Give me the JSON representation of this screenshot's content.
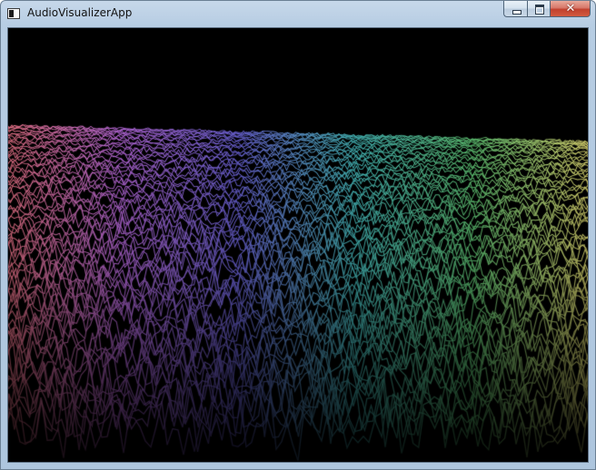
{
  "window": {
    "title": "AudioVisualizerApp",
    "app_icon": "console-window-icon"
  },
  "caption_buttons": {
    "minimize_icon": "minimize-icon",
    "maximize_icon": "maximize-icon",
    "close_icon": "close-icon",
    "close_glyph": "✕"
  },
  "visualizer": {
    "background_color": "#000000",
    "spectrum_colors": [
      "#e87080",
      "#b466d8",
      "#6a62d6",
      "#44b8b8",
      "#5cc070",
      "#e0d870"
    ]
  }
}
